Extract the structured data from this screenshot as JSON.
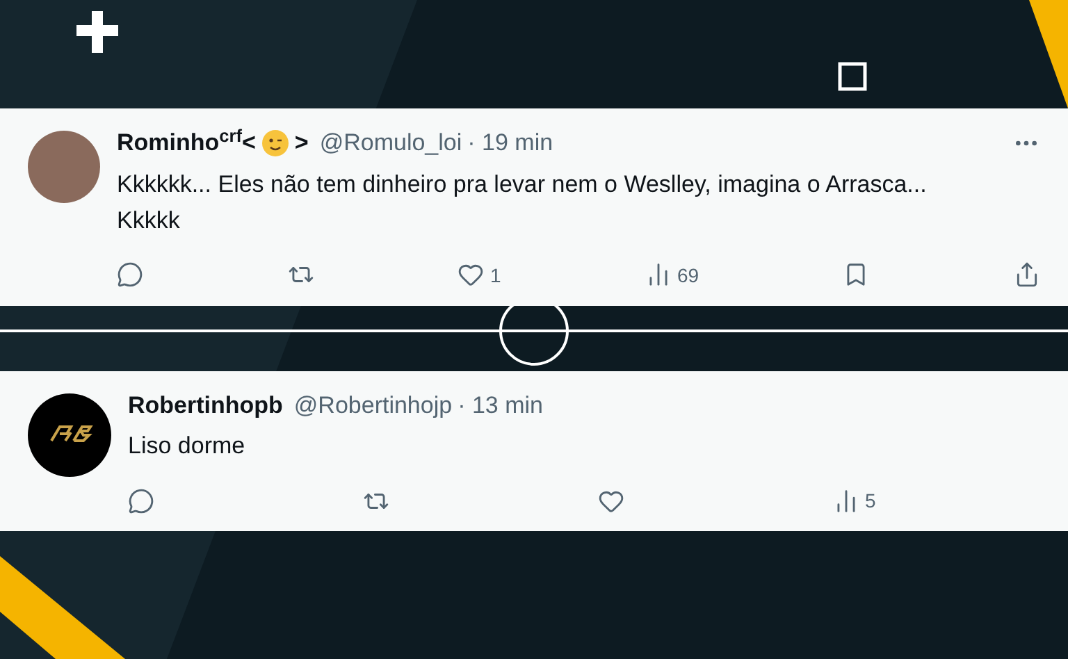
{
  "posts": [
    {
      "name": "Rominho$^{crf}$<",
      "name_suffix": ">",
      "has_emoji": true,
      "handle": "@Romulo_loi",
      "time": "· 19 min",
      "avatar": {
        "kind": "photo"
      },
      "more": true,
      "text": "Kkkkkk... Eles não tem dinheiro pra levar nem o Weslley, imagina o Arrasca... Kkkkk",
      "actions": [
        {
          "kind": "reply"
        },
        {
          "kind": "repost"
        },
        {
          "kind": "like",
          "count": "1"
        },
        {
          "kind": "views",
          "count": "69"
        },
        {
          "kind": "bookmark"
        },
        {
          "kind": "share"
        }
      ]
    },
    {
      "name": "Robertinhopb",
      "has_emoji": false,
      "handle": "@Robertinhojp",
      "time": "· 13 min",
      "avatar": {
        "kind": "logo"
      },
      "more": false,
      "text": "Liso dorme",
      "actions": [
        {
          "kind": "reply"
        },
        {
          "kind": "repost"
        },
        {
          "kind": "like"
        },
        {
          "kind": "views",
          "count": "5"
        }
      ]
    }
  ]
}
